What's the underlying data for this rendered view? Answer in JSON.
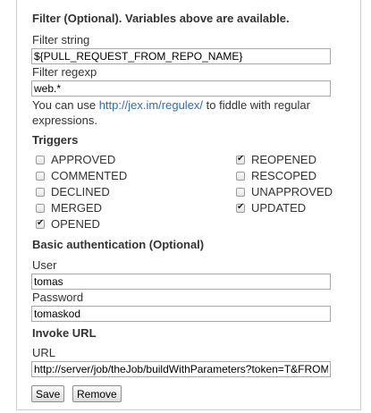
{
  "filter": {
    "heading": "Filter (Optional). Variables above are available.",
    "string_label": "Filter string",
    "string_value": "${PULL_REQUEST_FROM_REPO_NAME}",
    "regexp_label": "Filter regexp",
    "regexp_value": "web.*",
    "help_prefix": "You can use ",
    "help_link": "http://jex.im/regulex/",
    "help_suffix": " to fiddle with regular",
    "help_line2": "expressions."
  },
  "triggers": {
    "heading": "Triggers",
    "items": [
      {
        "label": "APPROVED",
        "checked": false
      },
      {
        "label": "REOPENED",
        "checked": true
      },
      {
        "label": "COMMENTED",
        "checked": false
      },
      {
        "label": "RESCOPED",
        "checked": false
      },
      {
        "label": "DECLINED",
        "checked": false
      },
      {
        "label": "UNAPPROVED",
        "checked": false
      },
      {
        "label": "MERGED",
        "checked": false
      },
      {
        "label": "UPDATED",
        "checked": true
      },
      {
        "label": "OPENED",
        "checked": true
      }
    ]
  },
  "auth": {
    "heading": "Basic authentication (Optional)",
    "user_label": "User",
    "user_value": "tomas",
    "password_label": "Password",
    "password_value": "tomaskod"
  },
  "invoke": {
    "heading": "Invoke URL",
    "url_label": "URL",
    "url_value": "http://server/job/theJob/buildWithParameters?token=T&FROM_REPO=${PULL_REQUEST_FROM_REPO_NAME}"
  },
  "buttons": {
    "save": "Save",
    "remove": "Remove"
  }
}
